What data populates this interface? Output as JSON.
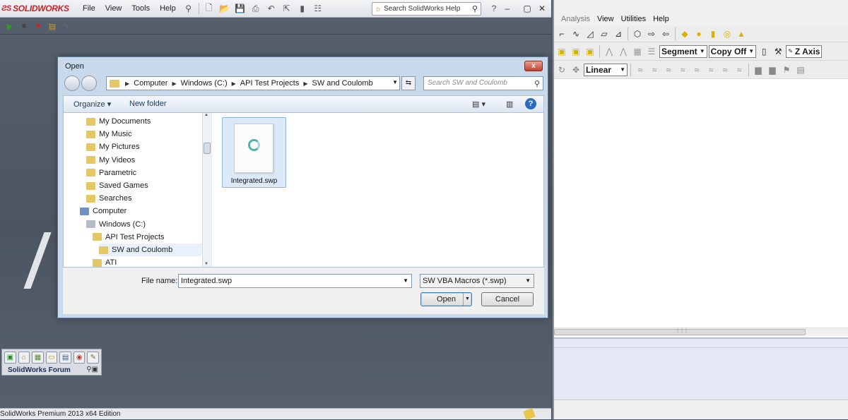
{
  "solidworks": {
    "logo": "SOLIDWORKS",
    "menu": [
      "File",
      "View",
      "Tools",
      "Help"
    ],
    "search_placeholder": "Search SolidWorks Help",
    "taskpane_title": "SolidWorks Forum",
    "status_text": "SolidWorks Premium 2013 x64 Edition"
  },
  "dialog": {
    "title": "Open",
    "close_glyph": "x",
    "breadcrumb": [
      "Computer",
      "Windows (C:)",
      "API Test Projects",
      "SW and Coulomb"
    ],
    "search_placeholder": "Search SW and Coulomb",
    "organize_label": "Organize",
    "new_folder_label": "New folder",
    "tree": [
      {
        "label": "My Documents",
        "indent": 2,
        "icon": "folder-icon"
      },
      {
        "label": "My Music",
        "indent": 2,
        "icon": "folder-icon"
      },
      {
        "label": "My Pictures",
        "indent": 2,
        "icon": "folder-icon"
      },
      {
        "label": "My Videos",
        "indent": 2,
        "icon": "folder-icon"
      },
      {
        "label": "Parametric",
        "indent": 2,
        "icon": "folder-icon"
      },
      {
        "label": "Saved Games",
        "indent": 2,
        "icon": "folder-icon"
      },
      {
        "label": "Searches",
        "indent": 2,
        "icon": "folder-icon"
      },
      {
        "label": "Computer",
        "indent": 1,
        "icon": "computer-icon"
      },
      {
        "label": "Windows (C:)",
        "indent": 2,
        "icon": "drive-icon"
      },
      {
        "label": "API Test Projects",
        "indent": 3,
        "icon": "folder-icon"
      },
      {
        "label": "SW and Coulomb",
        "indent": 4,
        "icon": "folder-icon",
        "selected": true
      },
      {
        "label": "ATI",
        "indent": 3,
        "icon": "folder-icon"
      }
    ],
    "file": {
      "name": "Integrated.swp"
    },
    "file_name_label": "File name:",
    "file_name_value": "Integrated.swp",
    "file_type_value": "SW VBA Macros (*.swp)",
    "open_label": "Open",
    "cancel_label": "Cancel"
  },
  "right_window": {
    "menu": [
      "Analysis",
      "View",
      "Utilities",
      "Help"
    ],
    "segment_combo": "Segment",
    "copy_combo": "Copy Off",
    "axis_combo": "Z Axis",
    "interp_combo": "Linear"
  }
}
